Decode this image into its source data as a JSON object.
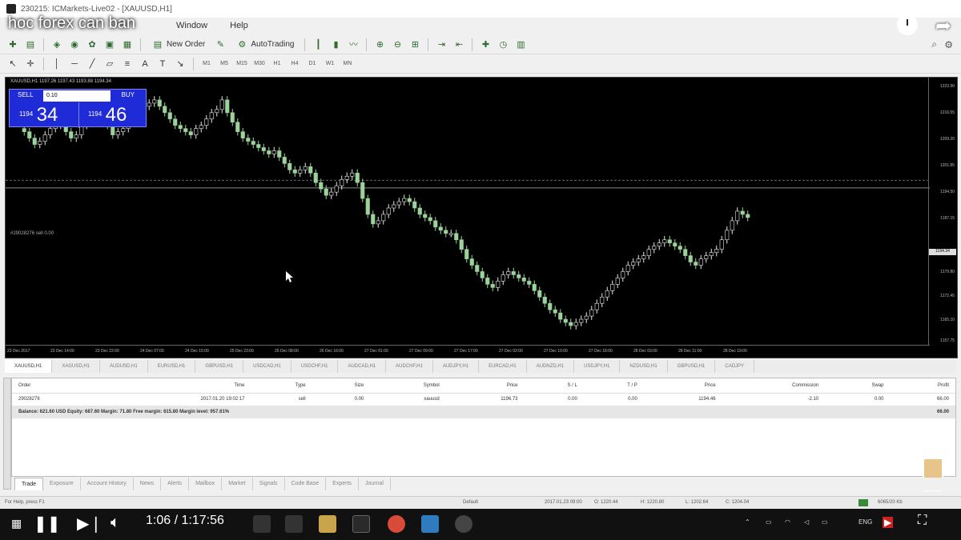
{
  "window": {
    "title": "230215: ICMarkets-Live02 - [XAUUSD,H1]",
    "overlay_title": "hoc forex can ban",
    "menu": [
      "Window",
      "Help"
    ]
  },
  "toolbar": {
    "new_order": "New Order",
    "autotrading": "AutoTrading"
  },
  "chart": {
    "header": "XAUUSD,H1 1197.26 1197.43 1193.88 1194.34",
    "one_click": {
      "sell_label": "SELL",
      "buy_label": "BUY",
      "lot": "0.10",
      "sell_price_small": "1194",
      "sell_price_big": "34",
      "buy_price_small": "1194",
      "buy_price_big": "46"
    },
    "order_line_label": "#29028276 sell 0.00",
    "current_price": "1194.34",
    "price_ticks": [
      "1223.90",
      "1216.55",
      "1209.20",
      "1201.85",
      "1194.50",
      "1187.15",
      "1179.80",
      "1172.45",
      "1165.10",
      "1157.75"
    ],
    "time_ticks": [
      "23 Dec 2017",
      "23 Dec 14:00",
      "23 Dec 22:00",
      "24 Dec 07:00",
      "24 Dec 15:00",
      "25 Dec 23:00",
      "26 Dec 08:00",
      "26 Dec 16:00",
      "27 Dec 01:00",
      "27 Dec 09:00",
      "27 Dec 17:00",
      "27 Dec 02:00",
      "27 Dec 10:00",
      "27 Dec 18:00",
      "28 Dec 03:00",
      "28 Dec 11:00",
      "28 Dec 19:00"
    ]
  },
  "chart_data": {
    "type": "candlestick",
    "symbol": "XAUUSD",
    "timeframe": "H1",
    "close_series": [
      1212,
      1210,
      1208,
      1209,
      1211,
      1213,
      1214,
      1215,
      1212,
      1210,
      1211,
      1214,
      1217,
      1219,
      1218,
      1216,
      1214,
      1211,
      1212,
      1213,
      1215,
      1217,
      1219,
      1220,
      1221,
      1222,
      1220,
      1218,
      1216,
      1214,
      1213,
      1212,
      1211,
      1213,
      1214,
      1216,
      1218,
      1219,
      1222,
      1218,
      1215,
      1212,
      1210,
      1209,
      1208,
      1207,
      1206,
      1205,
      1206,
      1204,
      1202,
      1200,
      1199,
      1200,
      1201,
      1199,
      1196,
      1194,
      1192,
      1193,
      1195,
      1197,
      1198,
      1199,
      1196,
      1191,
      1186,
      1183,
      1184,
      1186,
      1188,
      1189,
      1190,
      1191,
      1190,
      1188,
      1186,
      1185,
      1184,
      1182,
      1181,
      1180,
      1180,
      1178,
      1175,
      1172,
      1170,
      1168,
      1166,
      1164,
      1163,
      1165,
      1167,
      1168,
      1167,
      1166,
      1165,
      1164,
      1162,
      1160,
      1158,
      1156,
      1155,
      1153,
      1152,
      1151,
      1152,
      1153,
      1154,
      1156,
      1158,
      1160,
      1162,
      1164,
      1166,
      1168,
      1170,
      1171,
      1172,
      1173,
      1175,
      1176,
      1177,
      1178,
      1177,
      1176,
      1175,
      1173,
      1171,
      1170,
      1172,
      1173,
      1174,
      1175,
      1178,
      1181,
      1184,
      1187,
      1186,
      1185
    ],
    "ylim": [
      1150,
      1225
    ],
    "current_price": 1194.34,
    "order_line": 1196.73
  },
  "chart_tabs": [
    "XAUUSD,H1",
    "XAGUSD,H1",
    "AUDUSD,H1",
    "EURUSD,H1",
    "GBPUSD,H1",
    "USDCAD,H1",
    "USDCHF,H1",
    "AUDCAD,H1",
    "AUDCHF,H1",
    "AUDJPY,H1",
    "EURCAD,H1",
    "AUDNZD,H1",
    "USDJPY,H1",
    "NZDUSD,H1",
    "GBPUSD,H1",
    "CADJPY"
  ],
  "terminal": {
    "columns": [
      "Order",
      "Time",
      "Type",
      "Size",
      "Symbol",
      "Price",
      "S / L",
      "T / P",
      "Price",
      "Commission",
      "Swap",
      "Profit"
    ],
    "rows": [
      [
        "29028276",
        "2017.01.20 19:02:17",
        "sell",
        "0.00",
        "xauusd",
        "1196.73",
        "0.00",
        "0.00",
        "1194.46",
        "-2.10",
        "0.00",
        "66.00"
      ]
    ],
    "balance": "Balance: 621.60 USD  Equity: 687.60  Margin: 71.80  Free margin: 615.80  Margin level: 957.61%",
    "balance_profit": "66.00",
    "tabs": [
      "Trade",
      "Exposure",
      "Account History",
      "News",
      "Alerts",
      "Mailbox",
      "Market",
      "Signals",
      "Code Base",
      "Experts",
      "Journal"
    ]
  },
  "status": {
    "help": "For Help, press F1",
    "profile": "Default",
    "time": "2017.01.23 09:00",
    "open": "O: 1220.44",
    "high": "H: 1220.80",
    "low": "L: 1202.64",
    "close": "C: 1204.04",
    "bars": "6065/20 Kb"
  },
  "player": {
    "time": "1:06 / 1:17:56"
  },
  "tray": {
    "lang": "ENG"
  }
}
